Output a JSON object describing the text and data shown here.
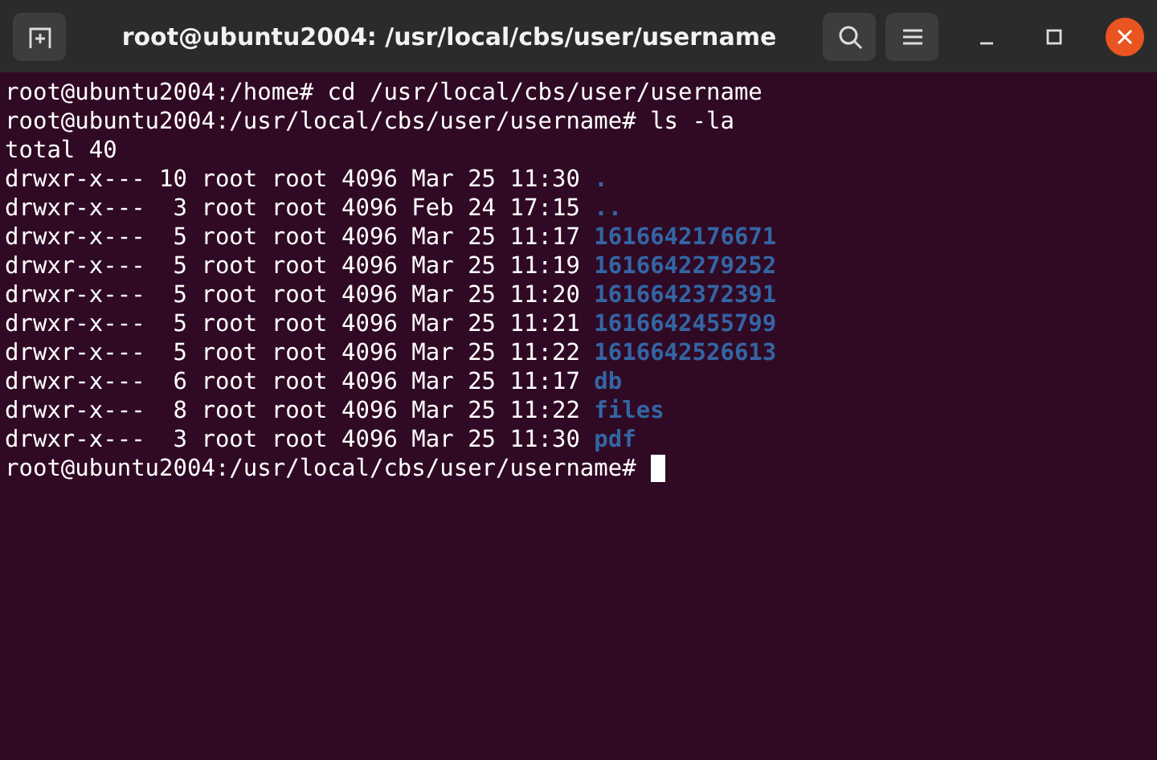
{
  "window": {
    "title": "root@ubuntu2004: /usr/local/cbs/user/username"
  },
  "terminal": {
    "lines": [
      {
        "kind": "plain",
        "text": "root@ubuntu2004:/home# cd /usr/local/cbs/user/username"
      },
      {
        "kind": "plain",
        "text": "root@ubuntu2004:/usr/local/cbs/user/username# ls -la"
      },
      {
        "kind": "plain",
        "text": "total 40"
      },
      {
        "kind": "entry",
        "text": "drwxr-x--- 10 root root 4096 Mar 25 11:30",
        "name": "."
      },
      {
        "kind": "entry",
        "text": "drwxr-x---  3 root root 4096 Feb 24 17:15",
        "name": ".."
      },
      {
        "kind": "entry",
        "text": "drwxr-x---  5 root root 4096 Mar 25 11:17",
        "name": "1616642176671"
      },
      {
        "kind": "entry",
        "text": "drwxr-x---  5 root root 4096 Mar 25 11:19",
        "name": "1616642279252"
      },
      {
        "kind": "entry",
        "text": "drwxr-x---  5 root root 4096 Mar 25 11:20",
        "name": "1616642372391"
      },
      {
        "kind": "entry",
        "text": "drwxr-x---  5 root root 4096 Mar 25 11:21",
        "name": "1616642455799"
      },
      {
        "kind": "entry",
        "text": "drwxr-x---  5 root root 4096 Mar 25 11:22",
        "name": "1616642526613"
      },
      {
        "kind": "entry",
        "text": "drwxr-x---  6 root root 4096 Mar 25 11:17",
        "name": "db"
      },
      {
        "kind": "entry",
        "text": "drwxr-x---  8 root root 4096 Mar 25 11:22",
        "name": "files"
      },
      {
        "kind": "entry",
        "text": "drwxr-x---  3 root root 4096 Mar 25 11:30",
        "name": "pdf"
      },
      {
        "kind": "prompt",
        "text": "root@ubuntu2004:/usr/local/cbs/user/username#"
      }
    ]
  }
}
